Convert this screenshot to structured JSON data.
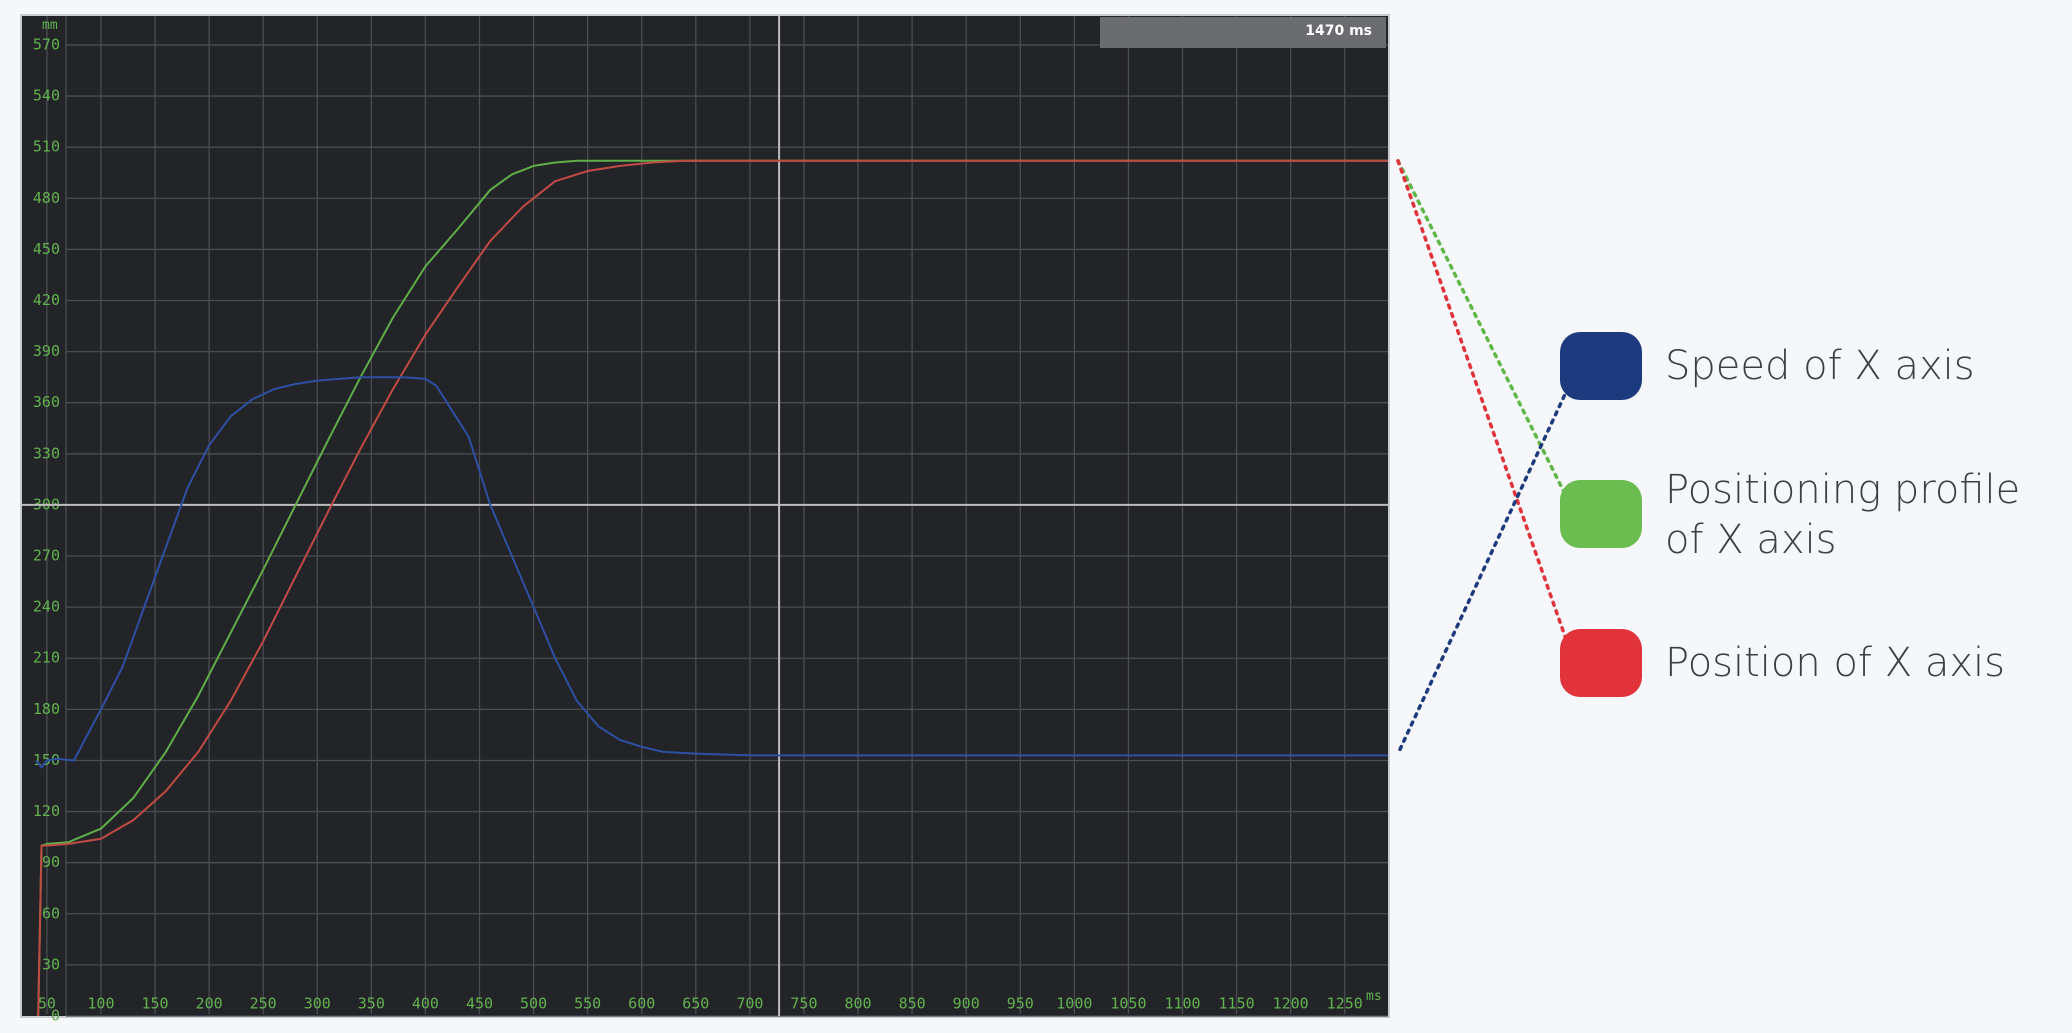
{
  "chart_data": {
    "type": "line",
    "x_unit": "ms",
    "y_unit": "mm",
    "xlim": [
      27,
      1290
    ],
    "ylim": [
      0,
      587
    ],
    "x_ticks": [
      50,
      100,
      150,
      200,
      250,
      300,
      350,
      400,
      450,
      500,
      550,
      600,
      650,
      700,
      750,
      800,
      850,
      900,
      950,
      1000,
      1050,
      1100,
      1150,
      1200,
      1250
    ],
    "y_ticks": [
      0,
      30,
      60,
      90,
      120,
      150,
      180,
      210,
      240,
      270,
      300,
      330,
      360,
      390,
      420,
      450,
      480,
      510,
      540,
      570
    ],
    "grid": true,
    "cursor": {
      "x": 727,
      "y": 300,
      "time_label": "1470 ms"
    },
    "series": [
      {
        "name": "Speed of X axis",
        "color": "#2e4fa3",
        "x": [
          40,
          45,
          50,
          60,
          75,
          85,
          100,
          120,
          140,
          160,
          180,
          200,
          220,
          240,
          260,
          280,
          300,
          320,
          340,
          360,
          380,
          400,
          410,
          420,
          440,
          460,
          480,
          500,
          520,
          540,
          560,
          580,
          600,
          620,
          650,
          700,
          750,
          800,
          1290
        ],
        "y": [
          150,
          146,
          150,
          151,
          150,
          162,
          180,
          205,
          240,
          275,
          310,
          335,
          352,
          362,
          368,
          371,
          373,
          374,
          375,
          375,
          375,
          374,
          370,
          360,
          340,
          300,
          270,
          240,
          210,
          185,
          170,
          162,
          158,
          155,
          154,
          153,
          153,
          153,
          153
        ]
      },
      {
        "name": "Positioning profile of X axis",
        "color": "#5fae4a",
        "x": [
          42,
          45,
          50,
          70,
          100,
          130,
          160,
          190,
          220,
          250,
          280,
          310,
          340,
          370,
          400,
          430,
          460,
          480,
          500,
          520,
          540,
          560,
          600,
          650,
          700,
          750,
          1290
        ],
        "y": [
          0,
          100,
          101,
          102,
          110,
          128,
          155,
          188,
          225,
          262,
          300,
          338,
          375,
          410,
          440,
          462,
          485,
          494,
          499,
          501,
          502,
          502,
          502,
          502,
          502,
          502,
          502
        ]
      },
      {
        "name": "Position of X axis",
        "color": "#c14a44",
        "x": [
          42,
          45,
          50,
          70,
          100,
          130,
          160,
          190,
          220,
          250,
          280,
          310,
          340,
          370,
          400,
          430,
          460,
          490,
          520,
          550,
          580,
          610,
          640,
          670,
          700,
          730,
          1290
        ],
        "y": [
          0,
          100,
          100,
          101,
          104,
          115,
          132,
          155,
          185,
          220,
          258,
          296,
          333,
          368,
          400,
          428,
          455,
          475,
          490,
          496,
          499,
          501,
          502,
          502,
          502,
          502,
          502
        ]
      }
    ]
  },
  "legend": {
    "items": [
      {
        "key": "speed",
        "line1": "Speed of X axis",
        "line2": "",
        "color": "#1d3a7e"
      },
      {
        "key": "profile",
        "line1": "Positioning profile",
        "line2": "of X axis",
        "color": "#6cbd4f"
      },
      {
        "key": "position",
        "line1": "Position of X axis",
        "line2": "",
        "color": "#e2323a"
      }
    ]
  },
  "connectors": {
    "speed_color": "#1d3a7e",
    "profile_color": "#5fb847",
    "position_color": "#e2323a"
  },
  "colors": {
    "plot_background": "#232427",
    "grid": "#4a4d52",
    "tick_text": "#62b24f",
    "frame": "#c8cbd0",
    "cursor": "#bdbdbd",
    "time_box": "#6a6c70"
  }
}
